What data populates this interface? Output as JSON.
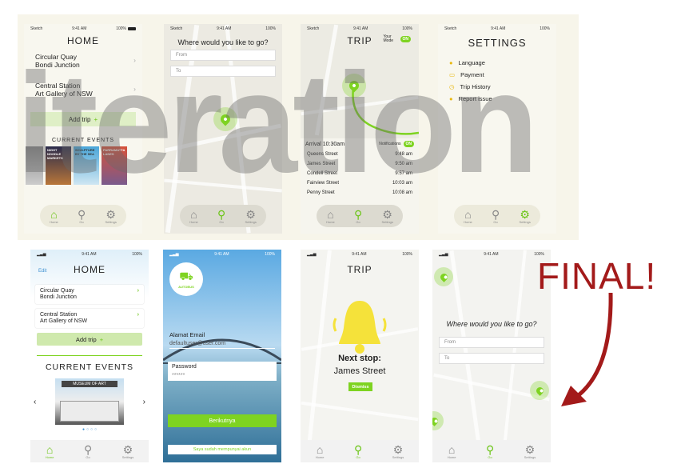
{
  "watermark": "iteration",
  "final_label": "FINAL!",
  "status": {
    "carrier": "Sketch",
    "time": "9:41 AM",
    "battery": "100%"
  },
  "tabs": {
    "home": "Home",
    "go": "Go",
    "settings": "Settings"
  },
  "s1": {
    "title": "HOME",
    "trips": [
      {
        "from": "Circular Quay",
        "to": "Bondi Junction"
      },
      {
        "from": "Central Station",
        "to": "Art Gallery of NSW"
      }
    ],
    "add_trip": "Add trip",
    "events_heading": "CURRENT EVENTS",
    "events": [
      "NIGHT NOODLE MARKETS",
      "SCULPTURE BY THE SEA",
      "PARRAMATTA LANES"
    ]
  },
  "s2": {
    "question": "Where would you like to go?",
    "from": "From",
    "to": "To"
  },
  "s3": {
    "title": "TRIP",
    "your_mode": "Your Mode",
    "toggle": "ON",
    "arrival": "Arrival 10:30am",
    "notifications": "Notifications",
    "stops": [
      {
        "name": "Queens Street",
        "time": "9:48 am"
      },
      {
        "name": "James Street",
        "time": "9:50 am"
      },
      {
        "name": "Condell Street",
        "time": "9:57 am"
      },
      {
        "name": "Fairview Street",
        "time": "10:03 am"
      },
      {
        "name": "Penny Street",
        "time": "10:08 am"
      }
    ]
  },
  "s4": {
    "title": "SETTINGS",
    "items": [
      "Language",
      "Payment",
      "Trip History",
      "Report issue"
    ]
  },
  "s5": {
    "edit": "Edit",
    "title": "HOME",
    "trips": [
      {
        "from": "Circular Quay",
        "to": "Bondi Junction"
      },
      {
        "from": "Central Station",
        "to": "Art Gallery of NSW"
      }
    ],
    "add_trip": "Add trip",
    "events_heading": "CURRENT EVENTS",
    "event_sign": "MUSEUM OF ART",
    "carousel_dots": 4,
    "carousel_active": 1
  },
  "s6": {
    "logo": "AUTOBUS",
    "email_label": "Alamat Email",
    "email_value": "defaultuser@user.com",
    "password_label": "Password",
    "password_value": "******",
    "next_button": "Berikutnya",
    "account_link": "Saya sudah mempunyai akun"
  },
  "s7": {
    "title": "TRIP",
    "next_stop_label": "Next stop:",
    "next_stop_value": "James Street",
    "dismiss": "Dismiss"
  },
  "s8": {
    "question": "Where would you like to go?",
    "from": "From",
    "to": "To"
  },
  "colors": {
    "accent": "#7ed321",
    "final": "#a31a1a",
    "sky": "#6fb6e6",
    "bell": "#f5e23a"
  }
}
